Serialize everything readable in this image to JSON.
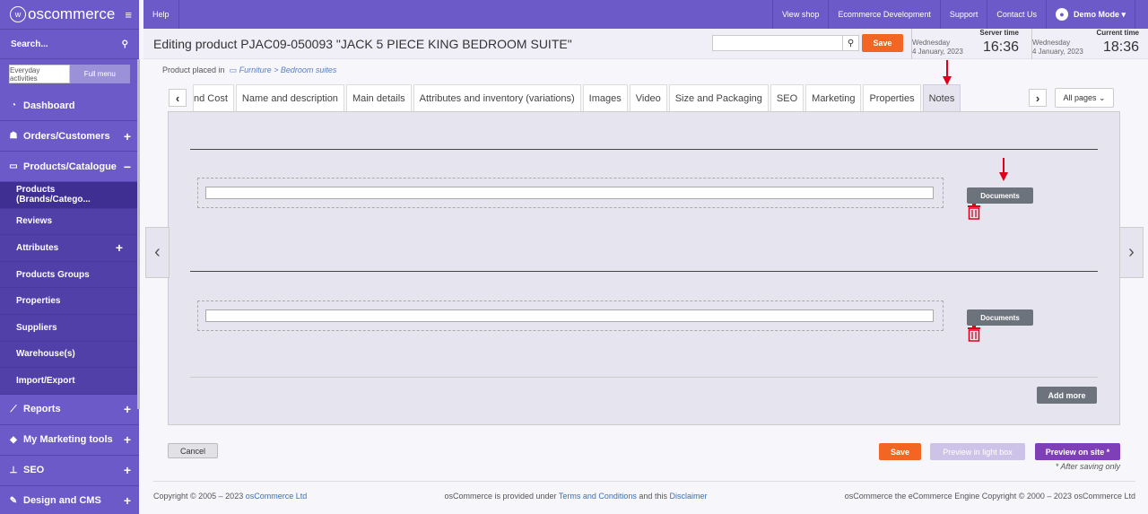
{
  "brand": {
    "logo_text": "oscommerce"
  },
  "sidebar": {
    "search_label": "Search...",
    "modes": [
      "Everyday activities",
      "Full menu"
    ],
    "items": [
      {
        "label": "Dashboard",
        "icon": "dashboard-icon"
      },
      {
        "label": "Orders/Customers",
        "icon": "users-icon"
      },
      {
        "label": "Products/Catalogue",
        "icon": "folder-icon"
      }
    ],
    "subitems": [
      "Products (Brands/Catego...",
      "Reviews",
      "Attributes",
      "Products Groups",
      "Properties",
      "Suppliers",
      "Warehouse(s)",
      "Import/Export"
    ],
    "items_bottom": [
      {
        "label": "Reports",
        "icon": "chart-icon"
      },
      {
        "label": "My Marketing tools",
        "icon": "tag-icon"
      },
      {
        "label": "SEO",
        "icon": "sitemap-icon"
      },
      {
        "label": "Design and CMS",
        "icon": "brush-icon"
      }
    ]
  },
  "topbar": {
    "help": "Help",
    "links": [
      "View shop",
      "Ecommerce Development",
      "Support",
      "Contact Us"
    ],
    "user": "Demo Mode"
  },
  "header": {
    "title": "Editing product PJAC09-050093 \"JACK 5 PIECE KING BEDROOM SUITE\"",
    "save": "Save",
    "server_label": "Server time",
    "server_day": "Wednesday",
    "server_date": "4 January, 2023",
    "server_time": "16:36",
    "current_label": "Current time",
    "current_day": "Wednesday",
    "current_date": "4 January, 2023",
    "current_time": "18:36"
  },
  "breadcrumb": {
    "prefix": "Product placed in",
    "path": "Furniture > Bedroom suites"
  },
  "tabs": [
    "nd Cost",
    "Name and description",
    "Main details",
    "Attributes and inventory (variations)",
    "Images",
    "Video",
    "Size and Packaging",
    "SEO",
    "Marketing",
    "Properties",
    "Notes"
  ],
  "active_tab": "Notes",
  "all_pages": "All pages",
  "documents_label": "Documents",
  "add_more": "Add more",
  "bottom": {
    "cancel": "Cancel",
    "save": "Save",
    "preview_lightbox": "Preview in light box",
    "preview_site": "Preview on site *",
    "after_note": "* After saving only"
  },
  "footer": {
    "left_text": "Copyright © 2005 – 2023",
    "left_link": "osCommerce Ltd",
    "mid_text1": "osCommerce is provided under",
    "mid_link1": "Terms and Conditions",
    "mid_text2": "and this",
    "mid_link2": "Disclaimer",
    "right_text": "osCommerce the eCommerce Engine Copyright © 2000 – 2023 osCommerce Ltd"
  },
  "colors": {
    "brand": "#6c5ac8",
    "save": "#f26522",
    "preview": "#7e3fb7",
    "annotation_arrow": "#e0001b"
  }
}
